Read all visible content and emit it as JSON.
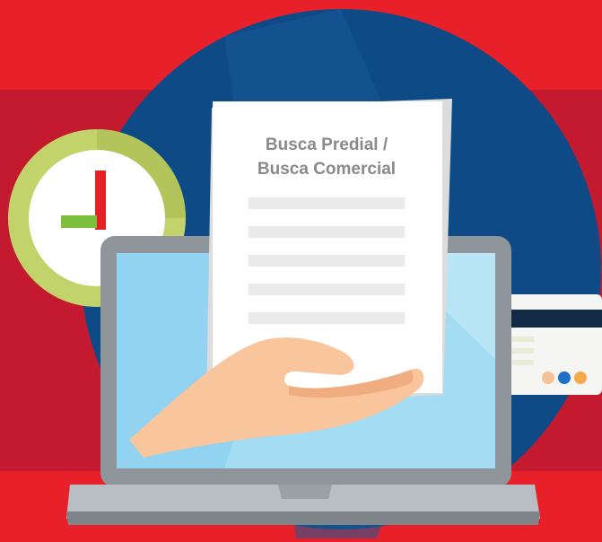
{
  "document": {
    "title_line_1": "Busca Predial /",
    "title_line_2": "Busca Comercial"
  },
  "icons": [
    "clock-icon",
    "laptop-icon",
    "document-icon",
    "hand-icon",
    "credit-card-icon"
  ],
  "colors": {
    "background_red": "#e8202a",
    "band_red": "#c41a30",
    "circle_blue": "#0d4a86",
    "clock_green": "#c3d36b",
    "clock_hand_red": "#e32026",
    "clock_hand_green": "#7bbf3c",
    "card_dot_orange": "#f6a94a",
    "card_dot_blue": "#1f6fc8"
  }
}
